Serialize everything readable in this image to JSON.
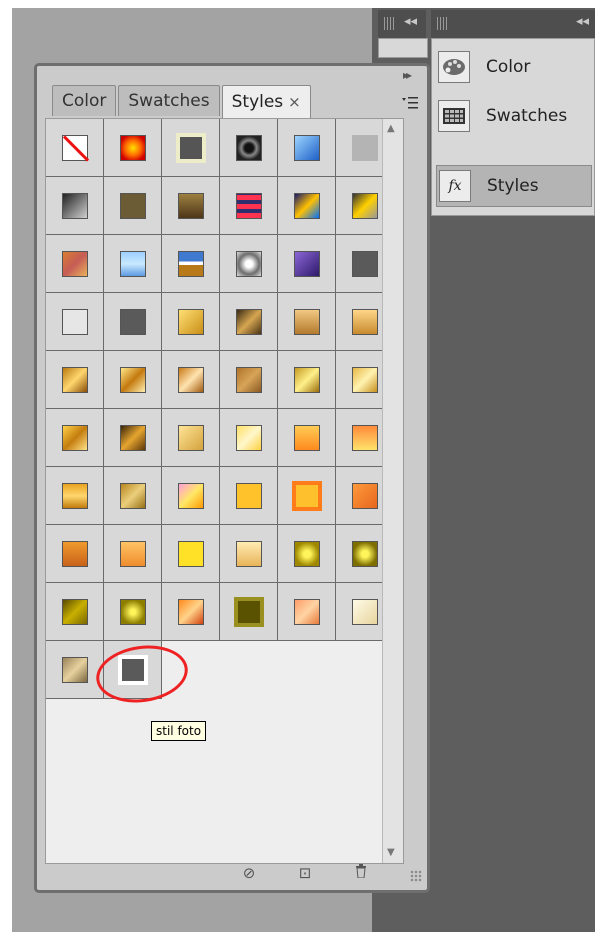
{
  "panel": {
    "tabs": [
      {
        "label": "Color"
      },
      {
        "label": "Swatches"
      },
      {
        "label": "Styles",
        "close": "×"
      }
    ],
    "menu_icon": "menu-icon",
    "arrows": "▸▸"
  },
  "dock": {
    "collapse_a": "◂◂",
    "collapse_b": "◂◂",
    "items": [
      {
        "label": "Color",
        "icon": "palette-icon"
      },
      {
        "label": "Swatches",
        "icon": "swatches-grid-icon"
      },
      {
        "label": "Styles",
        "icon": "fx-icon"
      }
    ],
    "fx_text": "fx"
  },
  "tooltip": "stil foto",
  "footer": {
    "clear_icon": "⊘",
    "new_icon": "⊡",
    "delete_icon": "🗑"
  },
  "styles": [
    {
      "name": "none",
      "bg": "#ffffff",
      "type": "none"
    },
    {
      "name": "style-2",
      "bg": "radial-gradient(circle,#ffe100 0%,#ff6b00 45%,#d10000 80%)"
    },
    {
      "name": "style-3",
      "bg": "#555555",
      "frame": "#ededc9"
    },
    {
      "name": "style-4",
      "bg": "radial-gradient(circle,#111 25%,#888 45%,#222 70%)"
    },
    {
      "name": "style-5",
      "bg": "linear-gradient(135deg,#9cd4ff,#1e60c7)"
    },
    {
      "name": "style-6",
      "bg": "#b4b4b4",
      "noborder": true
    },
    {
      "name": "style-7",
      "bg": "linear-gradient(135deg,#222,#d0d0d0)"
    },
    {
      "name": "style-8",
      "bg": "#6b5c35"
    },
    {
      "name": "style-9",
      "bg": "linear-gradient(180deg,#9c8040,#4e3618)"
    },
    {
      "name": "style-10",
      "bg": "repeating-linear-gradient(0deg,#ff3350 0 5px,#2f2f6f 5px 9px)"
    },
    {
      "name": "style-11",
      "bg": "linear-gradient(135deg,#1a1a6a,#ffc000 50%,#0070ff)"
    },
    {
      "name": "style-12",
      "bg": "linear-gradient(135deg,#333,#ffd000 50%,#999)"
    },
    {
      "name": "style-13",
      "bg": "linear-gradient(135deg,#d87d32,#c65c56 50%,#e9b35c)"
    },
    {
      "name": "style-14",
      "bg": "linear-gradient(180deg,#9ccfff,#c9e9ff 50%,#5d9ae0)"
    },
    {
      "name": "style-15",
      "bg": "linear-gradient(180deg,#3f7ad0 0 40%,#ffffff 40% 55%,#b87a18 55%)"
    },
    {
      "name": "style-16",
      "bg": "radial-gradient(circle,#ffffff 20%,#6d6d6d 60%,#dedede)"
    },
    {
      "name": "style-17",
      "bg": "linear-gradient(135deg,#8b66d6,#2e1a6b)"
    },
    {
      "name": "style-18",
      "bg": "#5a5a5a"
    },
    {
      "name": "style-19",
      "bg": "#e6e6e6",
      "noborder": false
    },
    {
      "name": "style-20",
      "bg": "#5a5a5a"
    },
    {
      "name": "style-21",
      "bg": "linear-gradient(135deg,#ffe074,#c98d16)"
    },
    {
      "name": "style-22",
      "bg": "linear-gradient(135deg,#3a2a14,#d6a651 50%,#4c3416)"
    },
    {
      "name": "style-23",
      "bg": "linear-gradient(180deg,#f2c882,#b27a2d)"
    },
    {
      "name": "style-24",
      "bg": "linear-gradient(180deg,#ffd68a,#c88b2e)"
    },
    {
      "name": "style-25",
      "bg": "linear-gradient(135deg,#ba7a12,#ffd66e 50%,#8a4e07)"
    },
    {
      "name": "style-26",
      "bg": "linear-gradient(135deg,#ffe88a,#c4790e 50%,#fff0b0)"
    },
    {
      "name": "style-27",
      "bg": "linear-gradient(135deg,#c97a18,#ffe3b0 50%,#a35c10)"
    },
    {
      "name": "style-28",
      "bg": "linear-gradient(135deg,#b07428,#d7a458 50%,#8b5a23)"
    },
    {
      "name": "style-29",
      "bg": "linear-gradient(135deg,#c59b22,#fff08a 50%,#9b6e0c)"
    },
    {
      "name": "style-30",
      "bg": "linear-gradient(135deg,#e7b749,#fff3b0 50%,#c88f1e)"
    },
    {
      "name": "style-31",
      "bg": "linear-gradient(135deg,#ffd24a,#c47d0e 50%,#ffe38a)"
    },
    {
      "name": "style-32",
      "bg": "linear-gradient(135deg,#3b2608,#e6a530 50%,#5d3808)"
    },
    {
      "name": "style-33",
      "bg": "linear-gradient(135deg,#ffe497,#d3a23d)"
    },
    {
      "name": "style-34",
      "bg": "linear-gradient(135deg,#ffe066,#fff7cc 50%,#ffd040)"
    },
    {
      "name": "style-35",
      "bg": "linear-gradient(180deg,#ffcc55,#ff8a1e)"
    },
    {
      "name": "style-36",
      "bg": "linear-gradient(180deg,#ff8a3a,#ffe36b)"
    },
    {
      "name": "style-37",
      "bg": "linear-gradient(180deg,#e9a321,#ffd76e 50%,#c27a0c)"
    },
    {
      "name": "style-38",
      "bg": "linear-gradient(135deg,#b98520,#ebcf7b 50%,#977019)"
    },
    {
      "name": "style-39",
      "bg": "linear-gradient(135deg,#ff9fd8,#ffe766 50%,#ff9900)"
    },
    {
      "name": "style-40",
      "bg": "#ffc22a"
    },
    {
      "name": "style-41",
      "bg": "#ffc02e",
      "frame": "#ff7c1a"
    },
    {
      "name": "style-42",
      "bg": "linear-gradient(135deg,#ff9a3a,#e6671e)"
    },
    {
      "name": "style-43",
      "bg": "linear-gradient(180deg,#f09a2c,#c8621a)"
    },
    {
      "name": "style-44",
      "bg": "linear-gradient(180deg,#ffc364,#ef8d2e)"
    },
    {
      "name": "style-45",
      "bg": "#ffe227"
    },
    {
      "name": "style-46",
      "bg": "linear-gradient(180deg,#ffebb3,#e8b459)"
    },
    {
      "name": "style-47",
      "bg": "radial-gradient(circle,#fff45a 20%,#9f8800 70%)"
    },
    {
      "name": "style-48",
      "bg": "radial-gradient(circle,#fff45a 20%,#7d6e00 70%)"
    },
    {
      "name": "style-49",
      "bg": "linear-gradient(135deg,#5a4a00,#c8b000 50%,#7a6800)"
    },
    {
      "name": "style-50",
      "bg": "radial-gradient(circle,#fff45a 15%,#8d7e00 70%)"
    },
    {
      "name": "style-51",
      "bg": "linear-gradient(135deg,#ff8a1e,#ffd38a 50%,#d2420e)"
    },
    {
      "name": "style-52",
      "bg": "#5a5200",
      "frame": "#9a9020"
    },
    {
      "name": "style-53",
      "bg": "linear-gradient(135deg,#ff9d6a,#ffd4a4 50%,#e77a3a)"
    },
    {
      "name": "style-54",
      "bg": "linear-gradient(135deg,#fffbe8,#e8d59e)"
    },
    {
      "name": "style-55",
      "bg": "linear-gradient(135deg,#9b845a,#e6d19e 50%,#7d6840)"
    },
    {
      "name": "stil foto",
      "bg": "#5a5a5a",
      "frame": "#ffffff"
    }
  ]
}
